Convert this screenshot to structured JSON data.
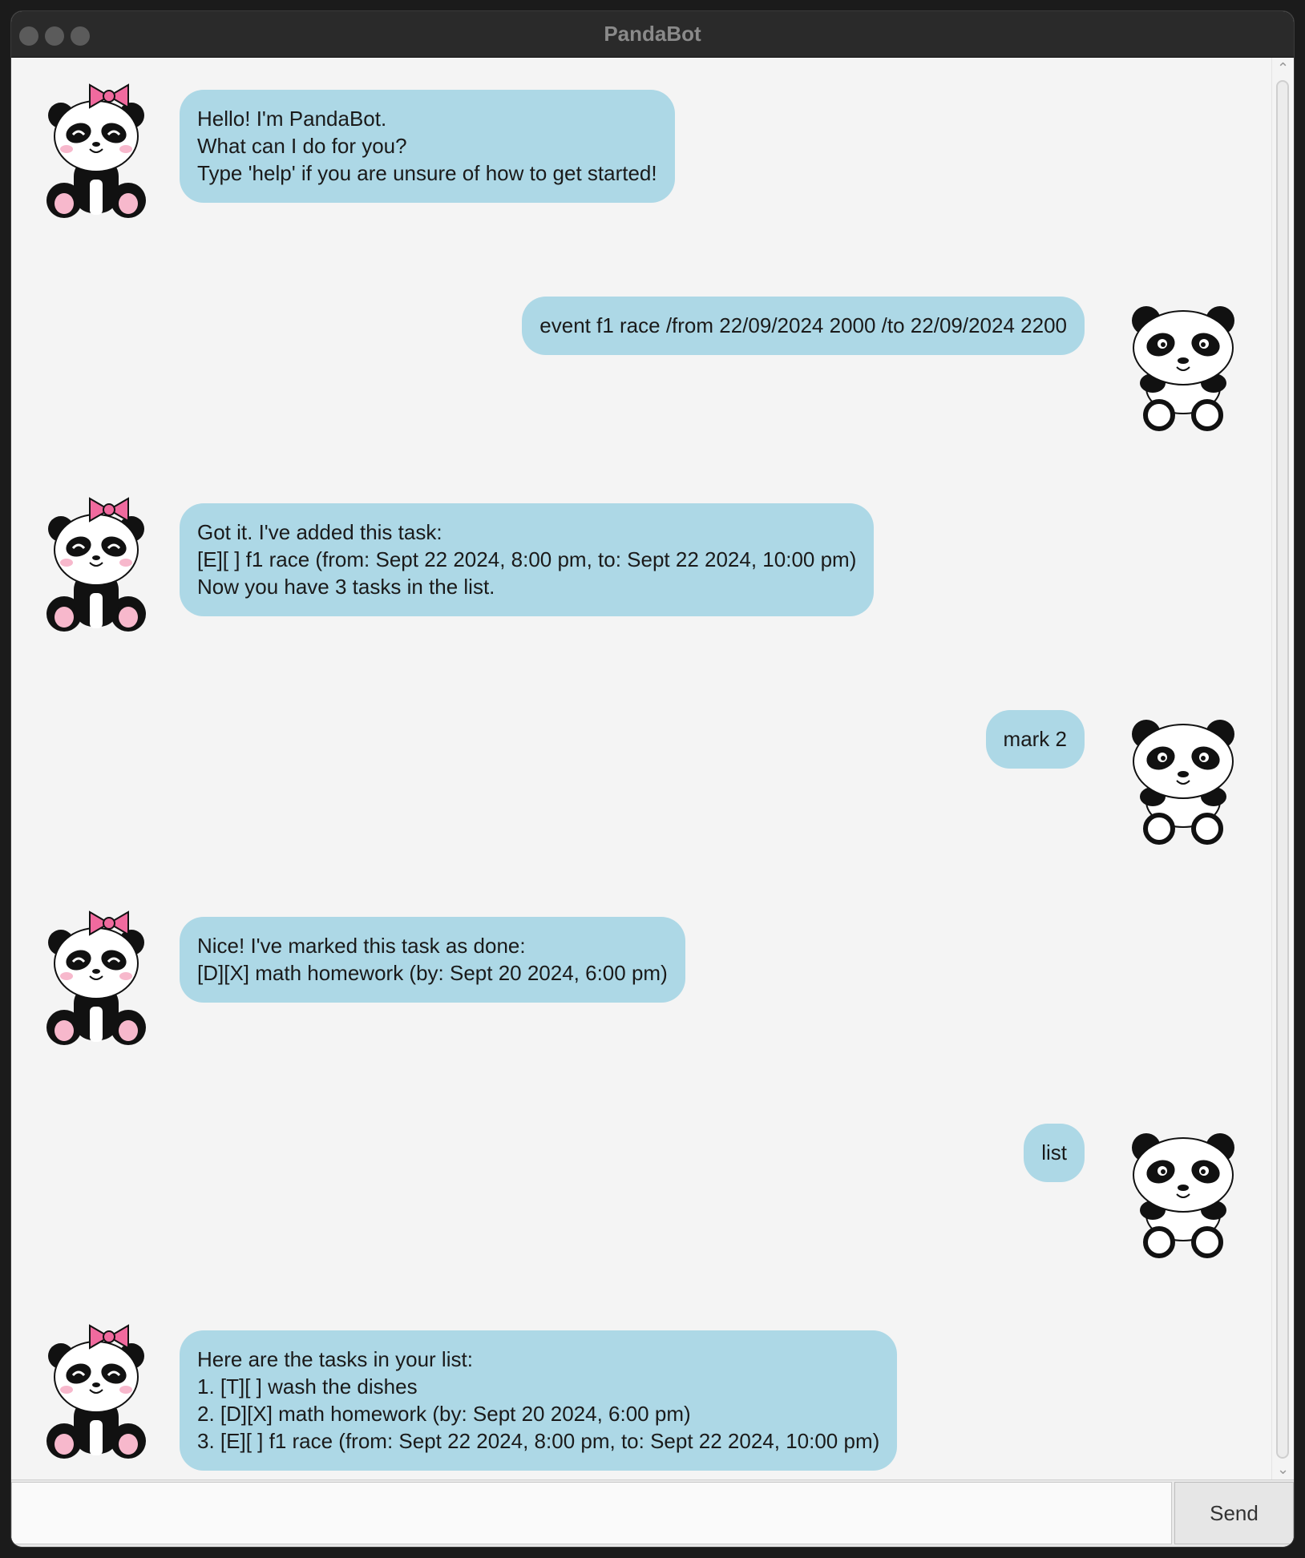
{
  "window": {
    "title": "PandaBot"
  },
  "conversation": {
    "m1": {
      "sender": "bot",
      "lines": [
        "Hello! I'm PandaBot.",
        "What can I do for you?",
        "Type 'help' if you are unsure of how to get started!"
      ]
    },
    "m2": {
      "sender": "user",
      "lines": [
        "event f1 race /from 22/09/2024 2000 /to 22/09/2024 2200"
      ]
    },
    "m3": {
      "sender": "bot",
      "lines": [
        "Got it. I've added this task:",
        "[E][ ] f1 race (from: Sept 22 2024, 8:00 pm, to: Sept 22 2024, 10:00 pm)",
        "Now you have 3 tasks in the list."
      ]
    },
    "m4": {
      "sender": "user",
      "lines": [
        "mark 2"
      ]
    },
    "m5": {
      "sender": "bot",
      "lines": [
        "Nice! I've marked this task as done:",
        "[D][X] math homework (by: Sept 20 2024, 6:00 pm)"
      ]
    },
    "m6": {
      "sender": "user",
      "lines": [
        "list"
      ]
    },
    "m7": {
      "sender": "bot",
      "lines": [
        "Here are the tasks in your list:",
        "1. [T][ ] wash the dishes",
        "2. [D][X] math homework (by: Sept 20 2024, 6:00 pm)",
        "3. [E][ ] f1 race (from: Sept 22 2024, 8:00 pm, to: Sept 22 2024, 10:00 pm)"
      ]
    }
  },
  "input": {
    "value": "",
    "placeholder": ""
  },
  "send_button": {
    "label": "Send"
  },
  "colors": {
    "bubble": "#add8e6",
    "chat_background": "#f4f4f4",
    "titlebar": "#2a2a2a",
    "bow": "#f06a9e",
    "blush": "#f7b8cc"
  },
  "icons": {
    "bot_avatar": "panda-with-bow-icon",
    "user_avatar": "panda-icon",
    "scroll_up": "chevron-up-icon",
    "scroll_down": "chevron-down-icon"
  }
}
